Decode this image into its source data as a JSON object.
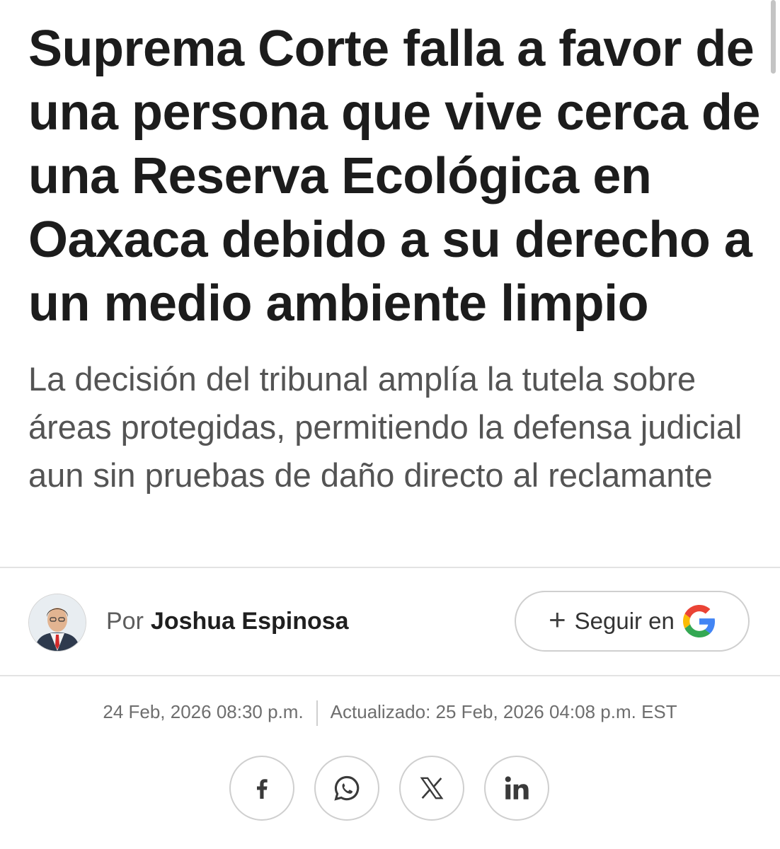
{
  "article": {
    "headline": "Suprema Corte falla a favor de una persona que vive cerca de una Reserva Ecológica en Oaxaca debido a su derecho a un medio ambiente limpio",
    "subheadline": "La decisión del tribunal amplía la tutela sobre áreas protegidas, permitiendo la defensa judicial aun sin pruebas de daño directo al reclamante"
  },
  "byline": {
    "prefix": "Por",
    "author": "Joshua Espinosa",
    "avatar_icon": "author-avatar"
  },
  "follow": {
    "plus": "+",
    "label": "Seguir en",
    "icon": "google-g-icon"
  },
  "dates": {
    "published": "24 Feb, 2026 08:30 p.m.",
    "updated": "Actualizado: 25 Feb, 2026 04:08 p.m. EST"
  },
  "share": {
    "icons": [
      "facebook-icon",
      "whatsapp-icon",
      "x-icon",
      "linkedin-icon"
    ]
  },
  "colors": {
    "headline": "#1c1c1c",
    "subhead": "#545454",
    "border": "#cfcfcf",
    "google_blue": "#4285F4",
    "google_red": "#EA4335",
    "google_yellow": "#FBBC05",
    "google_green": "#34A853"
  }
}
